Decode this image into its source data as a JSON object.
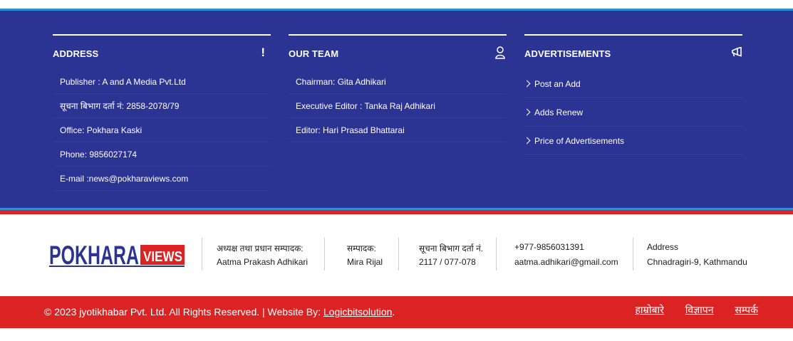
{
  "address": {
    "title": "ADDRESS",
    "icon": "exclamation-icon",
    "items": [
      "Publisher : A and A Media Pvt.Ltd",
      "सूचना बिभाग दर्ता नं: 2858-2078/79",
      "Office: Pokhara Kaski",
      "Phone: 9856027174",
      "E-mail :news@pokharaviews.com"
    ]
  },
  "team": {
    "title": "OUR TEAM",
    "icon": "user-icon",
    "items": [
      "Chairman: Gita Adhikari",
      "Executive Editor : Tanka Raj Adhikari",
      "Editor: Hari Prasad Bhattarai"
    ]
  },
  "ads": {
    "title": "ADVERTISEMENTS",
    "icon": "megaphone-icon",
    "items": [
      "Post an Add",
      "Adds Renew",
      "Price of Advertisements"
    ]
  },
  "logo": {
    "left": "POKHARA",
    "right": "VIEWS",
    "colors": {
      "blue": "#2c3493",
      "red": "#dc2323"
    }
  },
  "info": {
    "chief_label": "अध्यक्ष तथा प्रधान सम्पादक:",
    "chief_name": "Aatma Prakash Adhikari",
    "editor_label": "सम्पादक:",
    "editor_name": "Mira Rijal",
    "reg_label": "सूचना बिभाग दर्ता नं.",
    "reg_value": "2117 / 077-078",
    "phone": "+977-9856031391",
    "email": "aatma.adhikari@gmail.com",
    "address_label": "Address",
    "address_value": "Chnadragiri-9, Kathmandu"
  },
  "bottom": {
    "copyright": "© 2023 jyotikhabar Pvt. Ltd. All Rights Reserved. | Website By: ",
    "dev_link": "Logicbitsolution",
    "period": ".",
    "links": [
      "हाम्रोबारे",
      "विज्ञापन",
      "सम्पर्क"
    ]
  },
  "colors": {
    "footer_blue": "#2c3493",
    "accent_red": "#dc2323",
    "accent_lightblue": "#2b8fd8"
  }
}
